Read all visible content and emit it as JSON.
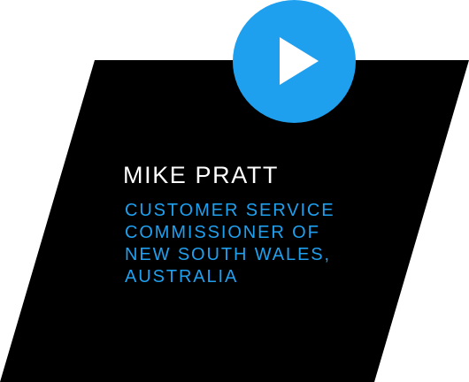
{
  "video_card": {
    "play_icon": "play-icon",
    "name": "MIKE PRATT",
    "title_lines": [
      "CUSTOMER SERVICE",
      "COMMISSIONER OF",
      "NEW SOUTH WALES,",
      "AUSTRALIA"
    ],
    "colors": {
      "card": "#000000",
      "accent": "#1fa0ef",
      "name_text": "#ffffff"
    }
  }
}
